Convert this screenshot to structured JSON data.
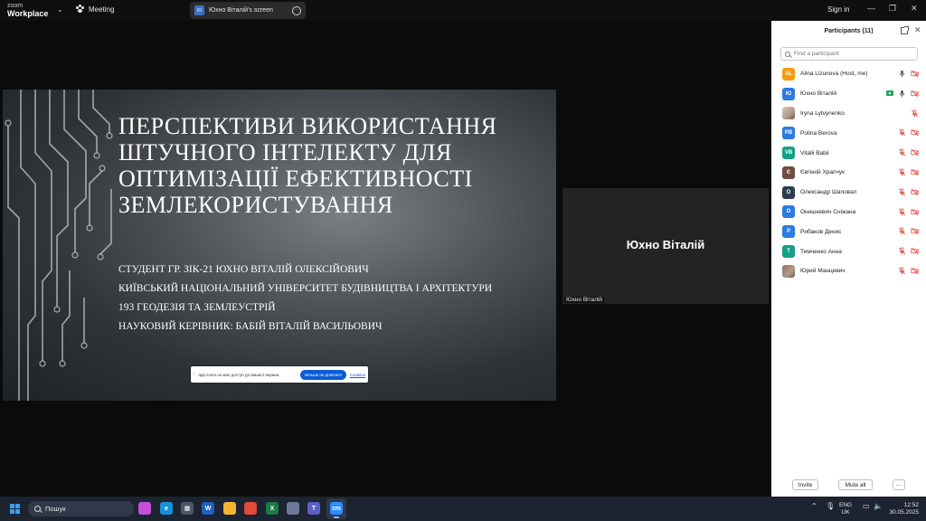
{
  "app": {
    "brand_small": "zoom",
    "brand_main": "Workplace",
    "meeting_label": "Meeting",
    "share_badge": "Ю",
    "share_title": "Юхно Віталій's screen",
    "signin_label": "Sign in",
    "window_controls": [
      "—",
      "❐",
      "✕"
    ]
  },
  "slide": {
    "title_lines": [
      "ПЕРСПЕКТИВИ ВИКОРИСТАННЯ",
      "ШТУЧНОГО ІНТЕЛЕКТУ ДЛЯ",
      "ОПТИМІЗАЦІЇ ЕФЕКТИВНОСТІ",
      "ЗЕМЛЕКОРИСТУВАННЯ"
    ],
    "subtitle_lines": [
      "СТУДЕНТ ГР. ЗІК-21 ЮХНО ВІТАЛІЙ ОЛЕКСІЙОВИЧ",
      "КИЇВСЬКИЙ НАЦІОНАЛЬНИЙ УНІВЕРСИТЕТ БУДІВНИЦТВА І АРХІТЕКТУРИ",
      "193 ГЕОДЕЗІЯ ТА ЗЕМЛЕУСТРІЙ",
      "НАУКОВИЙ КЕРІВНИК: БАБІЙ ВІТАЛІЙ ВАСИЛЬОВИЧ"
    ],
    "notice_text": "app.zoom.us має доступ до вашого екрана.",
    "notice_button": "Більше не ділитися",
    "notice_hide": "Сховати",
    "background_color": "#4e5357"
  },
  "video": {
    "display_name": "Юхно Віталій",
    "tile_label": "Юхно Віталій"
  },
  "participants": {
    "title": "Participants (11)",
    "search_placeholder": "Find a participant",
    "list": [
      {
        "initials": "AL",
        "name": "Alina Lizunova (Host, me)",
        "color": "#f39c12",
        "mic": "on",
        "video": "off",
        "sharing": false
      },
      {
        "initials": "Ю",
        "name": "Юхно Віталій",
        "color": "#2d7be0",
        "mic": "on",
        "video": "off",
        "sharing": true
      },
      {
        "initials": "",
        "name": "Iryna Lytvynenko",
        "color": "#d7c7b8",
        "mic": "off",
        "video": "none",
        "sharing": false,
        "photo": true
      },
      {
        "initials": "PB",
        "name": "Polina Berova",
        "color": "#2d7be0",
        "mic": "off",
        "video": "off",
        "sharing": false
      },
      {
        "initials": "VB",
        "name": "Vitalii Babii",
        "color": "#16a085",
        "mic": "off",
        "video": "off",
        "sharing": false
      },
      {
        "initials": "Є",
        "name": "Євгеній Храпчук",
        "color": "#6d4c41",
        "mic": "off",
        "video": "off",
        "sharing": false
      },
      {
        "initials": "О",
        "name": "Олександр Шаповал",
        "color": "#2c3e50",
        "mic": "off",
        "video": "off",
        "sharing": false
      },
      {
        "initials": "О",
        "name": "Онишкевич Сніжана",
        "color": "#2d7be0",
        "mic": "off",
        "video": "off",
        "sharing": false
      },
      {
        "initials": "Р",
        "name": "Рибаков Денис",
        "color": "#2d7be0",
        "mic": "off",
        "video": "off",
        "sharing": false
      },
      {
        "initials": "Т",
        "name": "Тимченко Анна",
        "color": "#16a085",
        "mic": "off",
        "video": "off",
        "sharing": false
      },
      {
        "initials": "",
        "name": "Юрий Манцевич",
        "color": "#8d6e63",
        "mic": "off",
        "video": "off",
        "sharing": false,
        "photo": true
      }
    ],
    "invite_label": "Invite",
    "mute_all_label": "Mute all",
    "more_label": "···"
  },
  "taskbar": {
    "search_label": "Пошук",
    "apps": [
      {
        "icon": "copilot-icon",
        "glyph": "",
        "color": "#c24fd8"
      },
      {
        "icon": "edge-icon",
        "glyph": "e",
        "color": "#1a8fd8"
      },
      {
        "icon": "calculator-icon",
        "glyph": "▦",
        "color": "#4b5566"
      },
      {
        "icon": "word-icon",
        "glyph": "W",
        "color": "#1f5fc1"
      },
      {
        "icon": "file-explorer-icon",
        "glyph": "",
        "color": "#f2b632"
      },
      {
        "icon": "chrome-icon",
        "glyph": "",
        "color": "#e04a3a"
      },
      {
        "icon": "excel-icon",
        "glyph": "X",
        "color": "#1e7a46"
      },
      {
        "icon": "save-disk-icon",
        "glyph": "",
        "color": "#6b7a94"
      },
      {
        "icon": "teams-icon",
        "glyph": "T",
        "color": "#5b5fc7"
      },
      {
        "icon": "zoom-icon",
        "glyph": "zm",
        "color": "#2d8cff"
      }
    ],
    "lang_top": "ENG",
    "lang_bottom": "UK",
    "time": "12:52",
    "date": "30.05.2025"
  }
}
